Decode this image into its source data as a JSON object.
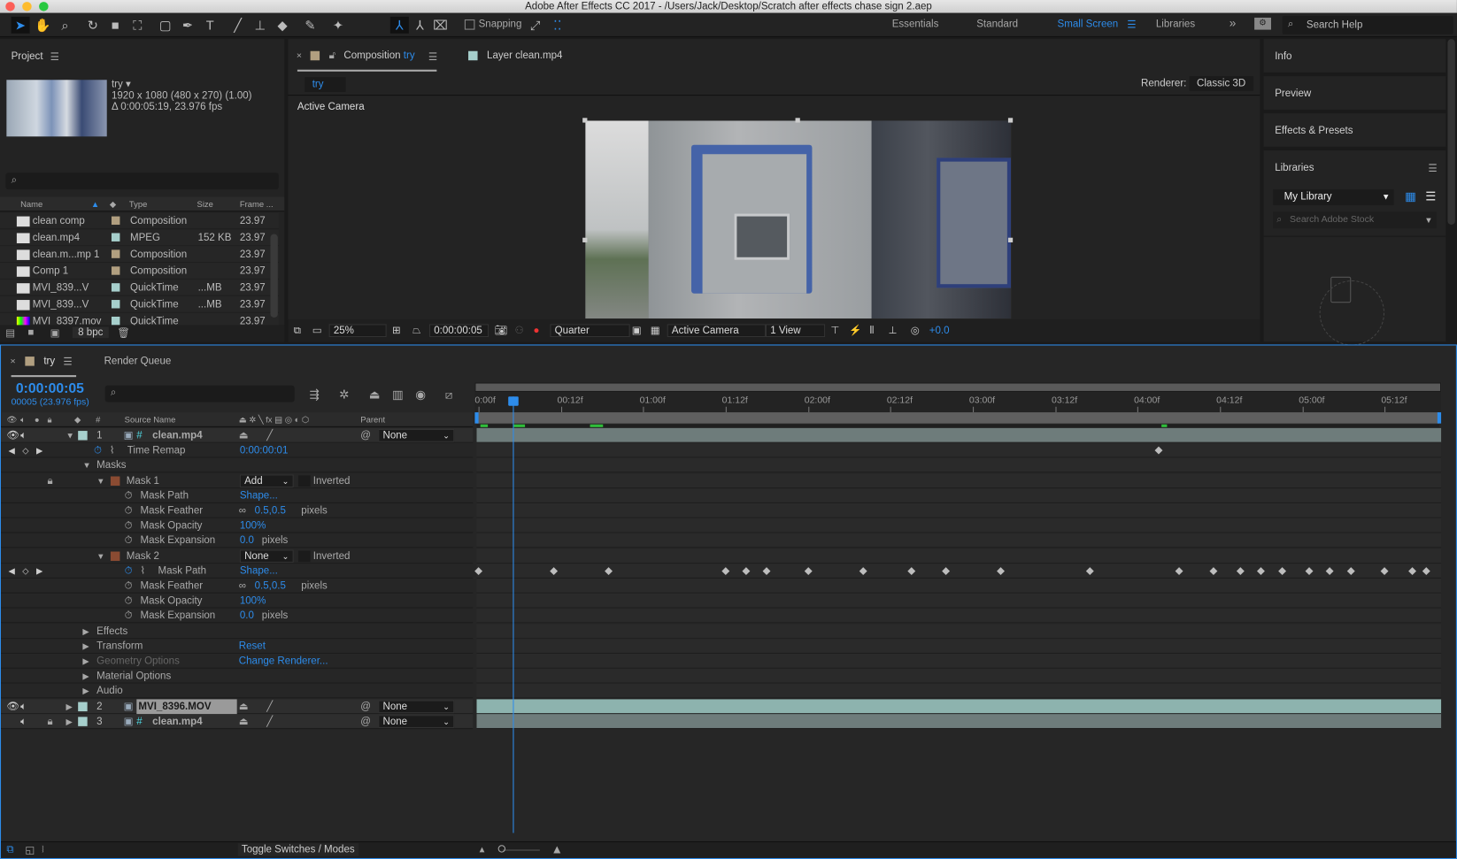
{
  "window": {
    "title": "Adobe After Effects CC 2017 - /Users/Jack/Desktop/Scratch after effects chase sign 2.aep"
  },
  "toolbar": {
    "snapping": "Snapping",
    "workspaces": [
      "Essentials",
      "Standard",
      "Small Screen",
      "Libraries"
    ],
    "active_workspace": "Small Screen",
    "search_placeholder": "Search Help",
    "accent": "#2d8ceb"
  },
  "project": {
    "title": "Project",
    "comp_name": "try ▾",
    "comp_size": "1920 x 1080  (480 x 270) (1.00)",
    "comp_duration": "Δ 0:00:05:19, 23.976 fps",
    "columns": [
      "Name",
      "Type",
      "Size",
      "Frame ..."
    ],
    "items": [
      {
        "name": "clean comp",
        "type": "Composition",
        "size": "",
        "frame": "23.97",
        "color": "#b19f80",
        "icon": "composition-icon"
      },
      {
        "name": "clean.mp4",
        "type": "MPEG",
        "size": "152 KB",
        "frame": "23.97",
        "color": "#a6cfcc",
        "icon": "footage-icon"
      },
      {
        "name": "clean.m...mp 1",
        "type": "Composition",
        "size": "",
        "frame": "23.97",
        "color": "#b19f80",
        "icon": "composition-icon"
      },
      {
        "name": "Comp 1",
        "type": "Composition",
        "size": "",
        "frame": "23.97",
        "color": "#b19f80",
        "icon": "composition-icon"
      },
      {
        "name": "MVI_839...V",
        "type": "QuickTime",
        "size": "...MB",
        "frame": "23.97",
        "color": "#a6cfcc",
        "icon": "footage-icon"
      },
      {
        "name": "MVI_839...V",
        "type": "QuickTime",
        "size": "...MB",
        "frame": "23.97",
        "color": "#a6cfcc",
        "icon": "footage-icon"
      },
      {
        "name": "MVI_8397.mov",
        "type": "QuickTime",
        "size": "",
        "frame": "23.97",
        "color": "#a6cfcc",
        "icon": "color-bars-icon"
      }
    ],
    "bpc": "8 bpc"
  },
  "viewer": {
    "tab_comp_prefix": "Composition",
    "tab_comp_name": "try",
    "tab_layer": "Layer clean.mp4",
    "breadcrumb": "try",
    "renderer_label": "Renderer:",
    "renderer": "Classic 3D",
    "camera_label": "Active Camera",
    "zoom": "25%",
    "time": "0:00:00:05",
    "resolution": "Quarter",
    "view_camera": "Active Camera",
    "views": "1 View",
    "exposure": "+0.0"
  },
  "right": {
    "panels": [
      "Info",
      "Preview",
      "Effects & Presets",
      "Libraries"
    ],
    "library": "My Library",
    "stock_placeholder": "Search Adobe Stock"
  },
  "timeline": {
    "tab": "try",
    "tab2": "Render Queue",
    "timecode": "0:00:00:05",
    "frames": "00005 (23.976 fps)",
    "columns": {
      "number": "#",
      "source": "Source Name",
      "parent": "Parent"
    },
    "ruler": [
      "0:00f",
      "00:12f",
      "01:00f",
      "01:12f",
      "02:00f",
      "02:12f",
      "03:00f",
      "03:12f",
      "04:00f",
      "04:12f",
      "05:00f",
      "05:12f"
    ],
    "playhead_frame": 5,
    "rows": [
      {
        "kind": "layer",
        "num": "1",
        "name": "clean.mp4",
        "parent": "None",
        "color": "#a6cfcc",
        "expanded": true,
        "eye": true,
        "precomp": true
      },
      {
        "kind": "prop",
        "indent": 1,
        "name": "Time Remap",
        "value": "0:00:00:01",
        "stopwatch": "active",
        "nav": true,
        "keyframes": [
          99
        ]
      },
      {
        "kind": "group",
        "indent": 0,
        "name": "Masks",
        "open": true
      },
      {
        "kind": "mask",
        "name": "Mask 1",
        "mode": "Add",
        "inverted": "Inverted",
        "lock": true
      },
      {
        "kind": "prop",
        "indent": 2,
        "name": "Mask Path",
        "value": "Shape..."
      },
      {
        "kind": "prop",
        "indent": 2,
        "name": "Mask Feather",
        "value": "0.5,0.5",
        "unit": "pixels",
        "link": true
      },
      {
        "kind": "prop",
        "indent": 2,
        "name": "Mask Opacity",
        "value": "100%"
      },
      {
        "kind": "prop",
        "indent": 2,
        "name": "Mask Expansion",
        "value": "0.0",
        "unit": "pixels"
      },
      {
        "kind": "mask",
        "name": "Mask 2",
        "mode": "None",
        "inverted": "Inverted"
      },
      {
        "kind": "prop",
        "indent": 3,
        "name": "Mask Path",
        "value": "Shape...",
        "stopwatch": "active",
        "nav": true,
        "keyframes": [
          0,
          11,
          19,
          36,
          39,
          42,
          48,
          56,
          63,
          68,
          76,
          89,
          102,
          107,
          111,
          114,
          117,
          121,
          124,
          127,
          132,
          136,
          138
        ]
      },
      {
        "kind": "prop",
        "indent": 2,
        "name": "Mask Feather",
        "value": "0.5,0.5",
        "unit": "pixels",
        "link": true
      },
      {
        "kind": "prop",
        "indent": 2,
        "name": "Mask Opacity",
        "value": "100%"
      },
      {
        "kind": "prop",
        "indent": 2,
        "name": "Mask Expansion",
        "value": "0.0",
        "unit": "pixels"
      },
      {
        "kind": "group",
        "indent": 0,
        "name": "Effects"
      },
      {
        "kind": "group",
        "indent": 0,
        "name": "Transform",
        "value": "Reset"
      },
      {
        "kind": "group",
        "indent": 0,
        "name": "Geometry Options",
        "value": "Change Renderer...",
        "dim": true
      },
      {
        "kind": "group",
        "indent": 0,
        "name": "Material Options"
      },
      {
        "kind": "group",
        "indent": 0,
        "name": "Audio"
      },
      {
        "kind": "layer",
        "num": "2",
        "name": "MVI_8396.MOV",
        "parent": "None",
        "color": "#a6cfcc",
        "eye": true,
        "selected": true
      },
      {
        "kind": "layer",
        "num": "3",
        "name": "clean.mp4",
        "parent": "None",
        "color": "#a6cfcc",
        "lock": true,
        "precomp": true
      }
    ],
    "toggle": "Toggle Switches / Modes"
  }
}
